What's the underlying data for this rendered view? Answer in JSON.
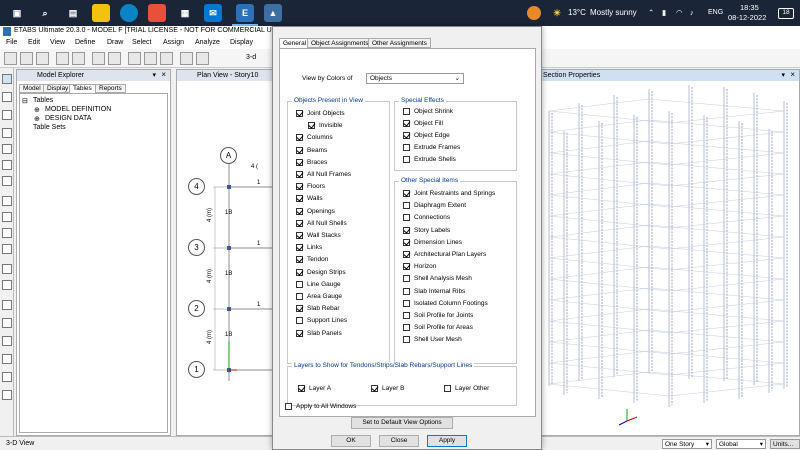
{
  "taskbar": {
    "weather_temp": "13°C",
    "weather_text": "Mostly sunny",
    "lang": "ENG",
    "time": "18:35",
    "date": "08-12-2022",
    "notif_count": "18"
  },
  "app": {
    "title": "ETABS Ultimate 20.3.0 - MODEL F  [TRIAL LICENSE - NOT FOR COMMERCIAL US",
    "menus": [
      "File",
      "Edit",
      "View",
      "Define",
      "Draw",
      "Select",
      "Assign",
      "Analyze",
      "Display"
    ],
    "toolbar_label": "3-d"
  },
  "explorer": {
    "title": "Model Explorer",
    "tabs": [
      "Model",
      "Display",
      "Tables",
      "Reports"
    ],
    "tree": {
      "root": "Tables",
      "child1": "MODEL DEFINITION",
      "child2": "DESIGN DATA",
      "sibling": "Table Sets"
    }
  },
  "plan": {
    "title": "Plan View - Story10",
    "grid_col": "A",
    "grid_rows": [
      "4",
      "3",
      "2",
      "1"
    ],
    "dim_label": "4 (m)",
    "dim_top": "4 (",
    "beam_label_1": "B",
    "beam_label_2": "1",
    "member": "1B"
  },
  "view3d": {
    "title": "Section Properties"
  },
  "status": {
    "left": "3-D View",
    "story": "One Story",
    "coord": "Global",
    "units": "Units..."
  },
  "dialog": {
    "tabs": [
      "General",
      "Object Assignments",
      "Other Assignments"
    ],
    "view_by_label": "View by Colors of",
    "view_by_value": "Objects",
    "objects_title": "Objects Present in View",
    "objects": [
      {
        "label": "Joint Objects",
        "checked": true
      },
      {
        "label": "Invisible",
        "checked": true
      },
      {
        "label": "Columns",
        "checked": true
      },
      {
        "label": "Beams",
        "checked": true
      },
      {
        "label": "Braces",
        "checked": true
      },
      {
        "label": "All Null Frames",
        "checked": true
      },
      {
        "label": "Floors",
        "checked": true
      },
      {
        "label": "Walls",
        "checked": true
      },
      {
        "label": "Openings",
        "checked": true
      },
      {
        "label": "All Null Shells",
        "checked": true
      },
      {
        "label": "Wall Stacks",
        "checked": true
      },
      {
        "label": "Links",
        "checked": true
      },
      {
        "label": "Tendon",
        "checked": true
      },
      {
        "label": "Design Strips",
        "checked": true
      },
      {
        "label": "Line Gauge",
        "checked": false
      },
      {
        "label": "Area Gauge",
        "checked": false
      },
      {
        "label": "Slab Rebar",
        "checked": true
      },
      {
        "label": "Support Lines",
        "checked": false
      },
      {
        "label": "Slab Panels",
        "checked": true
      }
    ],
    "effects_title": "Special Effects",
    "effects": [
      {
        "label": "Object Shrink",
        "checked": false
      },
      {
        "label": "Object Fill",
        "checked": true
      },
      {
        "label": "Object Edge",
        "checked": true
      },
      {
        "label": "Extrude Frames",
        "checked": false
      },
      {
        "label": "Extrude Shells",
        "checked": false
      }
    ],
    "other_title": "Other Special Items",
    "other": [
      {
        "label": "Joint Restraints and Springs",
        "checked": true
      },
      {
        "label": "Diaphragm Extent",
        "checked": false
      },
      {
        "label": "Connections",
        "checked": false
      },
      {
        "label": "Story Labels",
        "checked": true
      },
      {
        "label": "Dimension Lines",
        "checked": true
      },
      {
        "label": "Architectural Plan Layers",
        "checked": true
      },
      {
        "label": "Horizon",
        "checked": true
      },
      {
        "label": "Shell Analysis Mesh",
        "checked": false
      },
      {
        "label": "Slab Internal Ribs",
        "checked": false
      },
      {
        "label": "Isolated Column Footings",
        "checked": false
      },
      {
        "label": "Soil Profile for Joints",
        "checked": false
      },
      {
        "label": "Soil Profile for Areas",
        "checked": false
      },
      {
        "label": "Shell User Mesh",
        "checked": false
      }
    ],
    "layers_title": "Layers to Show for Tendons/Strips/Slab Rebars/Support Lines",
    "layers": [
      {
        "label": "Layer A",
        "checked": true
      },
      {
        "label": "Layer B",
        "checked": true
      },
      {
        "label": "Layer Other",
        "checked": false
      }
    ],
    "apply_all_label": "Apply to All Windows",
    "apply_all_checked": false,
    "default_btn": "Set to Default View Options",
    "ok": "OK",
    "close": "Close",
    "apply": "Apply"
  }
}
